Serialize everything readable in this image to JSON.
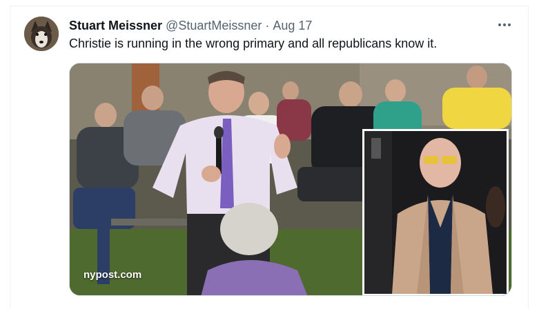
{
  "tweet": {
    "display_name": "Stuart Meissner",
    "handle": "@StuartMeissner",
    "separator": "·",
    "date": "Aug 17",
    "text": "Christie is running in the wrong primary and all republicans know it.",
    "more_icon": "more-horizontal-icon",
    "avatar_icon": "husky-dog-avatar"
  },
  "media": {
    "watermark": "nypost.com"
  }
}
